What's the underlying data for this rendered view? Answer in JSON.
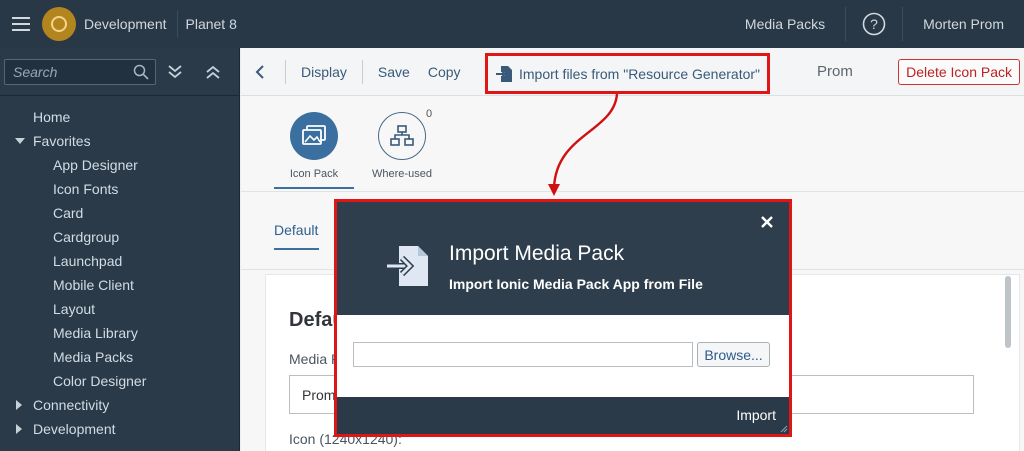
{
  "shell": {
    "system_name": "Development",
    "subtitle": "Planet 8",
    "media_packs_link": "Media Packs",
    "user_name": "Morten Prom"
  },
  "sidebar": {
    "search_placeholder": "Search",
    "items": [
      {
        "label": "Home"
      },
      {
        "label": "Favorites"
      },
      {
        "label": "App Designer"
      },
      {
        "label": "Icon Fonts"
      },
      {
        "label": "Card"
      },
      {
        "label": "Cardgroup"
      },
      {
        "label": "Launchpad"
      },
      {
        "label": "Mobile Client"
      },
      {
        "label": "Layout"
      },
      {
        "label": "Media Library"
      },
      {
        "label": "Media Packs"
      },
      {
        "label": "Color Designer"
      },
      {
        "label": "Connectivity"
      },
      {
        "label": "Development"
      }
    ]
  },
  "toolbar": {
    "display": "Display",
    "save": "Save",
    "copy": "Copy",
    "import": "Import files from \"Resource Generator\"",
    "title": "Prom",
    "delete": "Delete Icon Pack"
  },
  "header_tabs": {
    "icon_pack": "Icon Pack",
    "where_used": "Where-used",
    "where_used_count": "0"
  },
  "subtabs": {
    "default": "Default"
  },
  "form": {
    "title": "Defau",
    "label1": "Media P",
    "value1": "Prom",
    "label2": "Icon (1240x1240):"
  },
  "modal": {
    "title": "Import Media Pack",
    "subtitle": "Import Ionic Media Pack App from File",
    "file_value": "",
    "browse": "Browse...",
    "import": "Import"
  },
  "colors": {
    "shell_bg": "#283846",
    "sidebar_bg": "#2a3a48",
    "highlight": "#e01515",
    "accent": "#3a6fa0"
  }
}
